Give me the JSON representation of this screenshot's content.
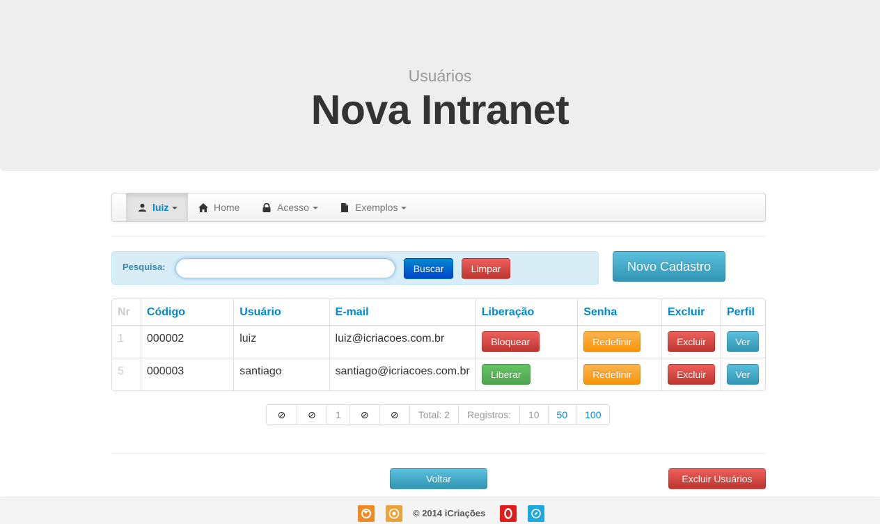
{
  "header": {
    "subtitle": "Usuários",
    "title": "Nova Intranet"
  },
  "navbar": {
    "items": [
      {
        "label": "luiz",
        "icon": "user-icon",
        "dropdown": true,
        "active": true
      },
      {
        "label": "Home",
        "icon": "home-icon",
        "dropdown": false
      },
      {
        "label": "Acesso",
        "icon": "lock-icon",
        "dropdown": true
      },
      {
        "label": "Exemplos",
        "icon": "file-icon",
        "dropdown": true
      }
    ]
  },
  "search": {
    "label": "Pesquisa:",
    "value": "",
    "buscar_label": "Buscar",
    "limpar_label": "Limpar"
  },
  "novo_cadastro_label": "Novo Cadastro",
  "table": {
    "headers": [
      "Nr",
      "Código",
      "Usuário",
      "E-mail",
      "Liberação",
      "Senha",
      "Excluir",
      "Perfil"
    ],
    "rows": [
      {
        "nr": "1",
        "codigo": "000002",
        "usuario": "luiz",
        "email": "luiz@icriacoes.com.br",
        "liberacao": "Bloquear",
        "liberacao_type": "danger",
        "senha": "Redefinir",
        "excluir": "Excluir",
        "perfil": "Ver"
      },
      {
        "nr": "5",
        "codigo": "000003",
        "usuario": "santiago",
        "email": "santiago@icriacoes.com.br",
        "liberacao": "Liberar",
        "liberacao_type": "success",
        "senha": "Redefinir",
        "excluir": "Excluir",
        "perfil": "Ver"
      }
    ]
  },
  "pagination": {
    "current_page": "1",
    "total": "Total: 2",
    "registros_label": "Registros:",
    "page_sizes": [
      "10",
      "50",
      "100"
    ]
  },
  "actions": {
    "voltar_label": "Voltar",
    "excluir_usuarios_label": "Excluir Usuários"
  },
  "footer": {
    "copyright": "©  2014 iCriações",
    "browsers": [
      "firefox-icon",
      "chrome-icon",
      "opera-icon",
      "safari-icon"
    ]
  },
  "colors": {
    "primary": "#0088cc",
    "danger": "#bd362f",
    "info": "#2f96b4",
    "success": "#51a351",
    "warning": "#f89406"
  }
}
